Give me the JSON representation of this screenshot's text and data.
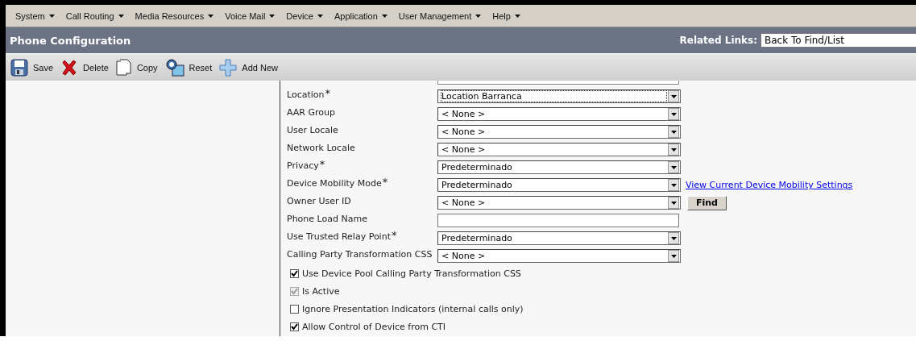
{
  "menu": [
    {
      "label": "System"
    },
    {
      "label": "Call Routing"
    },
    {
      "label": "Media Resources"
    },
    {
      "label": "Voice Mail"
    },
    {
      "label": "Device"
    },
    {
      "label": "Application"
    },
    {
      "label": "User Management"
    },
    {
      "label": "Help"
    }
  ],
  "header": {
    "title": "Phone Configuration",
    "related_links_label": "Related Links:",
    "related_links_value": "Back To Find/List"
  },
  "toolbar": [
    {
      "kind": "save",
      "label": "Save"
    },
    {
      "kind": "delete",
      "label": "Delete"
    },
    {
      "kind": "copy",
      "label": "Copy"
    },
    {
      "kind": "reset",
      "label": "Reset"
    },
    {
      "kind": "add",
      "label": "Add New"
    }
  ],
  "fields": [
    {
      "kind": "select",
      "label": "Location",
      "required_mark": "*",
      "value": "Location Barranca",
      "focused": true
    },
    {
      "kind": "select",
      "label": "AAR Group",
      "value": "< None >",
      "focused": false
    },
    {
      "kind": "select",
      "label": "User Locale",
      "value": "< None >",
      "focused": false
    },
    {
      "kind": "select",
      "label": "Network Locale",
      "value": "< None >",
      "focused": false
    },
    {
      "kind": "select",
      "label": "Privacy",
      "required_mark": "*",
      "value": "Predeterminado",
      "focused": false
    },
    {
      "kind": "select",
      "label": "Device Mobility Mode",
      "required_mark": "*",
      "value": "Predeterminado",
      "focused": false,
      "link": "View Current Device Mobility Settings"
    },
    {
      "kind": "select",
      "label": "Owner User ID",
      "value": "< None >",
      "focused": false,
      "button": "Find"
    },
    {
      "kind": "text",
      "label": "Phone Load Name",
      "focused": false
    },
    {
      "kind": "select",
      "label": "Use Trusted Relay Point",
      "required_mark": "*",
      "value": "Predeterminado",
      "focused": false
    },
    {
      "kind": "select",
      "label": "Calling Party Transformation CSS",
      "value": "< None >",
      "focused": false
    }
  ],
  "checkboxes": [
    {
      "label": "Use Device Pool Calling Party Transformation CSS",
      "checked": true,
      "disabled": false
    },
    {
      "label": "Is Active",
      "checked": true,
      "disabled": true
    },
    {
      "label": "Ignore Presentation Indicators (internal calls only)",
      "checked": false,
      "disabled": false
    },
    {
      "label": "Allow Control of Device from CTI",
      "checked": true,
      "disabled": false
    }
  ]
}
